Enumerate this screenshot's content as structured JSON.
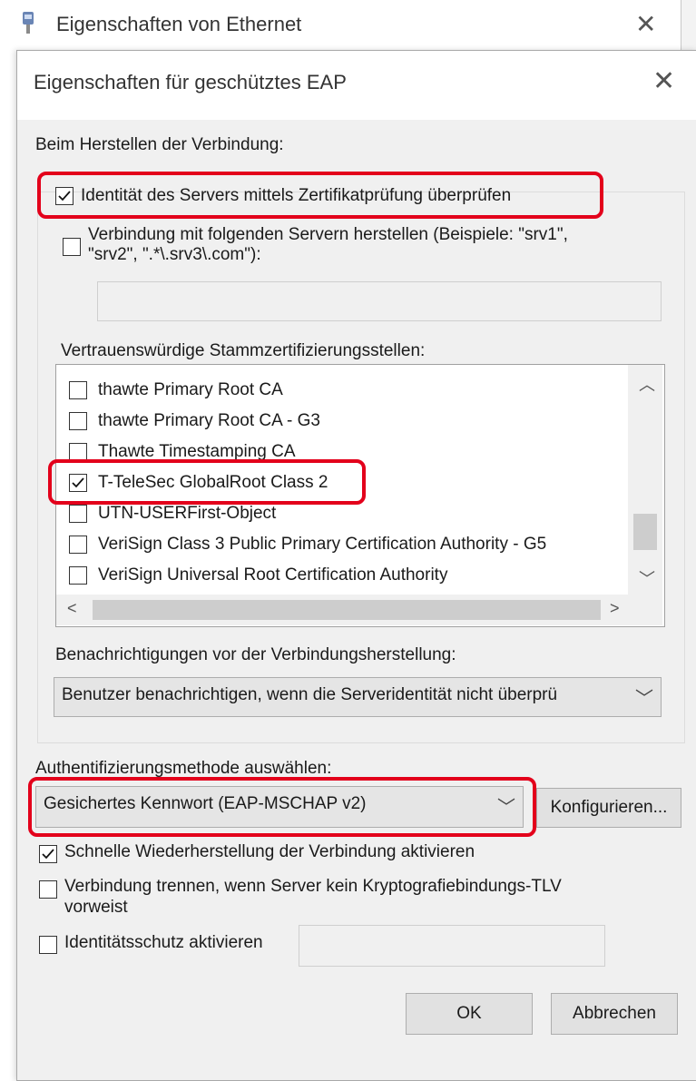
{
  "back_window": {
    "title": "Eigenschaften von Ethernet",
    "close_glyph": "✕"
  },
  "dialog": {
    "title": "Eigenschaften für geschütztes EAP",
    "close_glyph": "✕",
    "connection_heading": "Beim Herstellen der Verbindung:",
    "verify_identity": {
      "label": "Identität des Servers mittels Zertifikatprüfung überprüfen",
      "checked": true
    },
    "connect_servers": {
      "label_line1": "Verbindung mit folgenden Servern herstellen (Beispiele: \"srv1\",",
      "label_line2": "\"srv2\", \".*\\.srv3\\.com\"):",
      "checked": false,
      "value": ""
    },
    "trusted_ca_heading": "Vertrauenswürdige Stammzertifizierungsstellen:",
    "ca_list": [
      {
        "label": "thawte Primary Root CA",
        "checked": false
      },
      {
        "label": "thawte Primary Root CA - G3",
        "checked": false
      },
      {
        "label": "Thawte Timestamping CA",
        "checked": false
      },
      {
        "label": "T-TeleSec GlobalRoot Class 2",
        "checked": true
      },
      {
        "label": "UTN-USERFirst-Object",
        "checked": false
      },
      {
        "label": "VeriSign Class 3 Public Primary Certification Authority - G5",
        "checked": false
      },
      {
        "label": "VeriSign Universal Root Certification Authority",
        "checked": false
      }
    ],
    "notifications_heading": "Benachrichtigungen vor der Verbindungsherstellung:",
    "notifications_value": "Benutzer benachrichtigen, wenn die Serveridentität nicht überprü",
    "auth_heading": "Authentifizierungsmethode auswählen:",
    "auth_value": "Gesichertes Kennwort (EAP-MSCHAP v2)",
    "configure_label": "Konfigurieren...",
    "fast_reconnect": {
      "label": "Schnelle Wiederherstellung der Verbindung aktivieren",
      "checked": true
    },
    "disconnect_tlv": {
      "label_line1": "Verbindung trennen, wenn Server kein Kryptografiebindungs-TLV",
      "label_line2": "vorweist",
      "checked": false
    },
    "identity_privacy": {
      "label": "Identitätsschutz aktivieren",
      "checked": false,
      "value": ""
    },
    "ok_label": "OK",
    "cancel_label": "Abbrechen"
  },
  "colors": {
    "highlight": "#e3001b",
    "dialog_bg": "#f0f0f0"
  },
  "icons": {
    "app": "ethernet-device-icon",
    "check": "checkmark-icon"
  }
}
